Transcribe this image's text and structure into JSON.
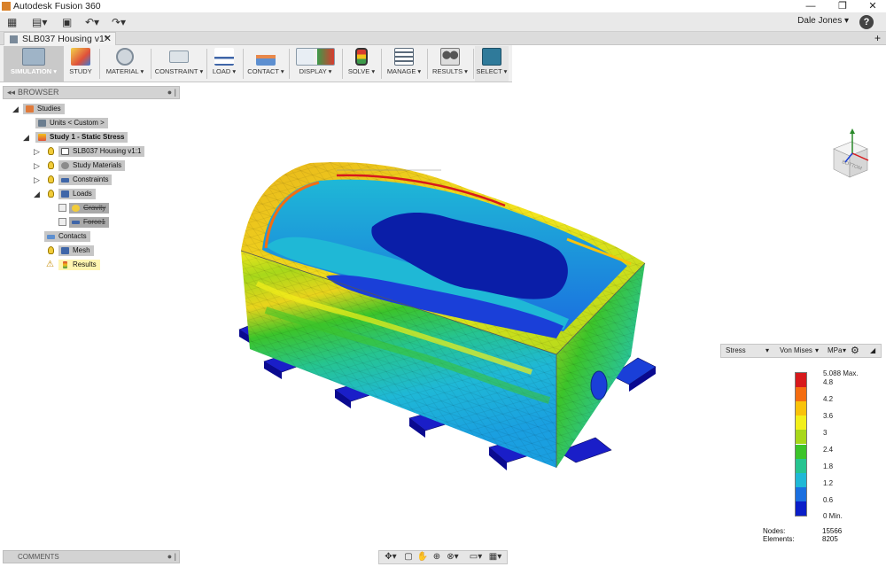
{
  "window": {
    "title": "Autodesk Fusion 360",
    "min": "—",
    "restore": "❐",
    "close": "✕"
  },
  "qat": {
    "grid": "▦",
    "file": "▤▾",
    "save": "▣",
    "undo": "↶▾",
    "redo": "↷▾"
  },
  "user": {
    "name": "Dale Jones ▾",
    "help": "?"
  },
  "doc_tab": {
    "label": "SLB037 Housing v1*",
    "close": "✕",
    "new": "+"
  },
  "toolbar": [
    {
      "id": "workspace",
      "label": "SIMULATION ▾",
      "icon": "simulation-cube-icon",
      "color": "#9fb4c7"
    },
    {
      "id": "study",
      "label": "STUDY",
      "icon": "study-icon",
      "color": "#e0503a"
    },
    {
      "id": "material",
      "label": "MATERIAL ▾",
      "icon": "material-icon",
      "color": "#7f8c99"
    },
    {
      "id": "constraint",
      "label": "CONSTRAINT ▾",
      "icon": "constraint-icon",
      "color": "#8a9aa8"
    },
    {
      "id": "load",
      "label": "LOAD ▾",
      "icon": "load-icon",
      "color": "#3f66a8"
    },
    {
      "id": "contact",
      "label": "CONTACT ▾",
      "icon": "contact-icon",
      "color": "#e8884a"
    },
    {
      "id": "display",
      "label": "DISPLAY ▾",
      "icon": "display-icon",
      "color": "#3c9a4a"
    },
    {
      "id": "solve",
      "label": "SOLVE ▾",
      "icon": "solve-icon",
      "color": "#d83b2f"
    },
    {
      "id": "manage",
      "label": "MANAGE ▾",
      "icon": "manage-icon",
      "color": "#5b6b7b"
    },
    {
      "id": "results",
      "label": "RESULTS ▾",
      "icon": "results-icon",
      "color": "#7a7a7a"
    },
    {
      "id": "select",
      "label": "SELECT ▾",
      "icon": "select-icon",
      "color": "#2f7a9a"
    }
  ],
  "browser": {
    "header": "BROWSER",
    "chev": "◂◂",
    "controls": "● |",
    "nodes": {
      "studies": "Studies",
      "units": "Units < Custom >",
      "study1": "Study 1 - Static Stress",
      "housing": "SLB037 Housing v1:1",
      "materials": "Study Materials",
      "constraints": "Constraints",
      "loads": "Loads",
      "gravity": "Gravity",
      "force": "Force1",
      "contacts": "Contacts",
      "mesh": "Mesh",
      "results": "Results"
    }
  },
  "legend": {
    "result_type": "Stress",
    "criterion": "Von Mises",
    "unit": "MPa",
    "ticks": [
      "5.088 Max.",
      "4.8",
      "4.2",
      "3.6",
      "3",
      "2.4",
      "1.8",
      "1.2",
      "0.6",
      "0 Min."
    ],
    "scale_colors": [
      "#d7191c",
      "#f46d10",
      "#f9c20a",
      "#f2ef1a",
      "#a8d81a",
      "#3cc42a",
      "#26c490",
      "#1fb8d6",
      "#1a6fe0",
      "#0a1ec8"
    ],
    "nodes_label": "Nodes:",
    "nodes_value": "15566",
    "elements_label": "Elements:",
    "elements_value": "8205"
  },
  "comments": {
    "label": "COMMENTS",
    "controls": "● |"
  },
  "navbar": {
    "orbit": "✥▾",
    "look": "▢",
    "pan": "✋",
    "zoom": "⊕",
    "fit": "⊗▾",
    "display": "▭▾",
    "grid": "▦▾"
  }
}
